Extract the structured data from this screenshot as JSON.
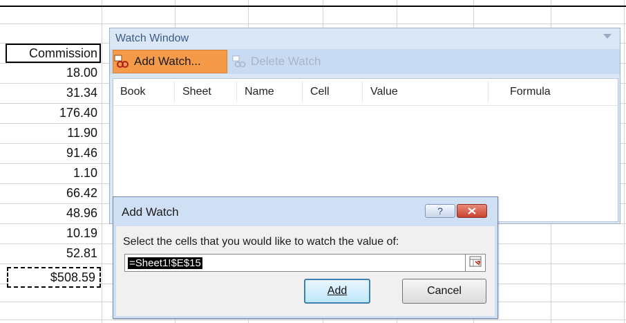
{
  "sheet": {
    "column_header": "Commission",
    "values": [
      "18.00",
      "31.34",
      "176.40",
      "11.90",
      "91.46",
      "1.10",
      "66.42",
      "48.96",
      "10.19",
      "52.81"
    ],
    "total": "$508.59"
  },
  "watch_window": {
    "title": "Watch Window",
    "add_watch_label": "Add Watch...",
    "delete_watch_label": "Delete Watch",
    "columns": [
      "Book",
      "Sheet",
      "Name",
      "Cell",
      "Value",
      "Formula"
    ]
  },
  "add_watch_dialog": {
    "title": "Add Watch",
    "help_label": "?",
    "prompt": "Select the cells that you would like to watch the value of:",
    "reference_value": "=Sheet1!$E$15",
    "add_label": "Add",
    "cancel_label": "Cancel"
  },
  "colors": {
    "accent_orange": "#f59a48",
    "close_red": "#c84430",
    "window_blue": "#dce7f5"
  }
}
